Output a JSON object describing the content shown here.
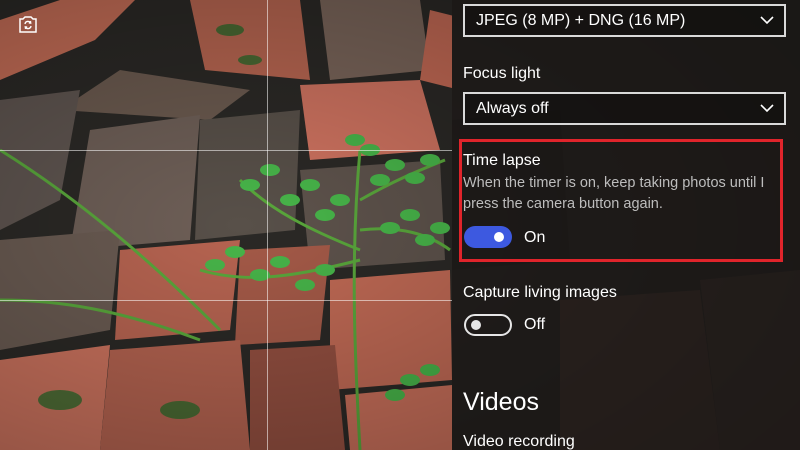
{
  "camera": {
    "switch_icon": "camera-switch-icon"
  },
  "settings": {
    "photo_quality": {
      "value": "JPEG (8 MP) + DNG (16 MP)"
    },
    "focus_light": {
      "label": "Focus light",
      "value": "Always off"
    },
    "time_lapse": {
      "label": "Time lapse",
      "description": "When the timer is on, keep taking photos until I press the camera button again.",
      "state_label": "On",
      "enabled": true
    },
    "living_images": {
      "label": "Capture living images",
      "state_label": "Off",
      "enabled": false
    },
    "videos_heading": "Videos",
    "video_recording": {
      "label": "Video recording"
    }
  },
  "colors": {
    "accent": "#3d59e0",
    "highlight": "#e0242b",
    "pane": "#141211"
  }
}
